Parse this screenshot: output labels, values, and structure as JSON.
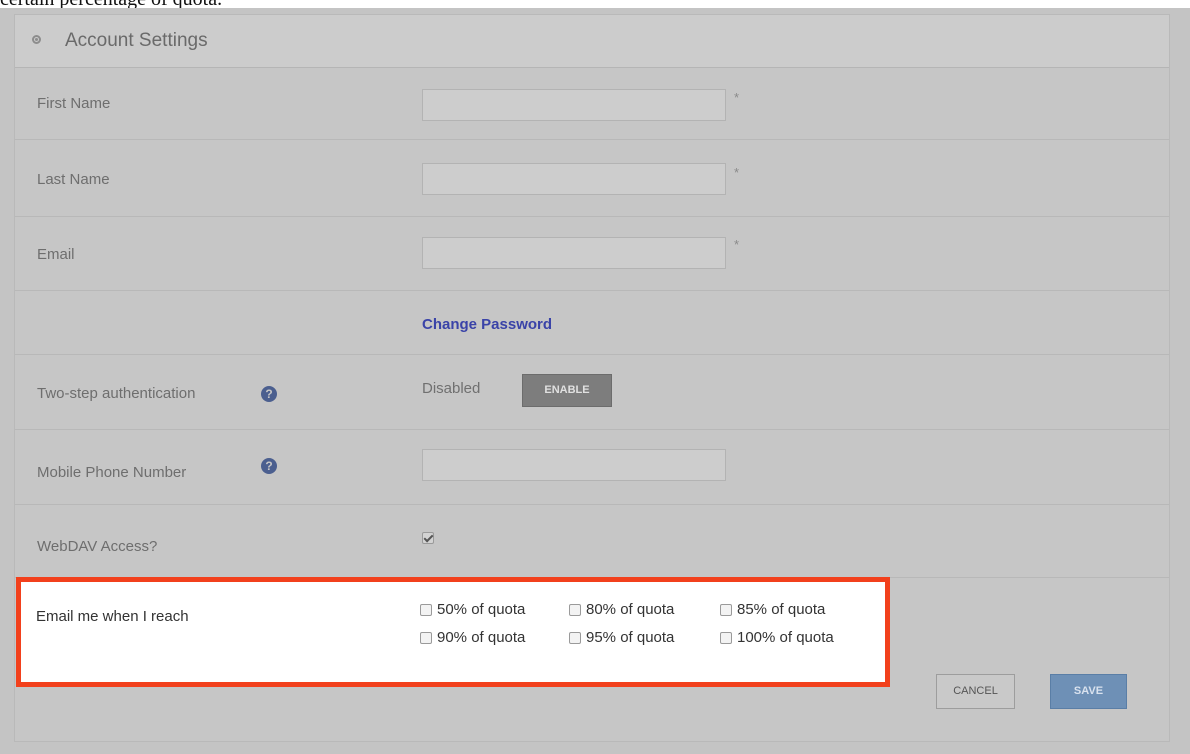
{
  "caption": "certain percentage of quota.",
  "panel": {
    "title": "Account Settings"
  },
  "fields": {
    "first_name_label": "First Name",
    "last_name_label": "Last Name",
    "email_label": "Email",
    "required_marker": "*"
  },
  "change_password": "Change Password",
  "two_step": {
    "label": "Two-step authentication",
    "status": "Disabled",
    "button": "ENABLE"
  },
  "mobile": {
    "label": "Mobile Phone Number"
  },
  "webdav": {
    "label": "WebDAV Access?",
    "checked": true
  },
  "notify": {
    "label": "Email me when I reach",
    "options": [
      "50% of quota",
      "80% of quota",
      "85% of quota",
      "90% of quota",
      "95% of quota",
      "100% of quota"
    ]
  },
  "actions": {
    "cancel": "CANCEL",
    "save": "SAVE"
  },
  "help_glyph": "?",
  "colors": {
    "highlight_border": "#f2401c",
    "save_button": "#6e90b6",
    "link": "#3a43a8"
  }
}
